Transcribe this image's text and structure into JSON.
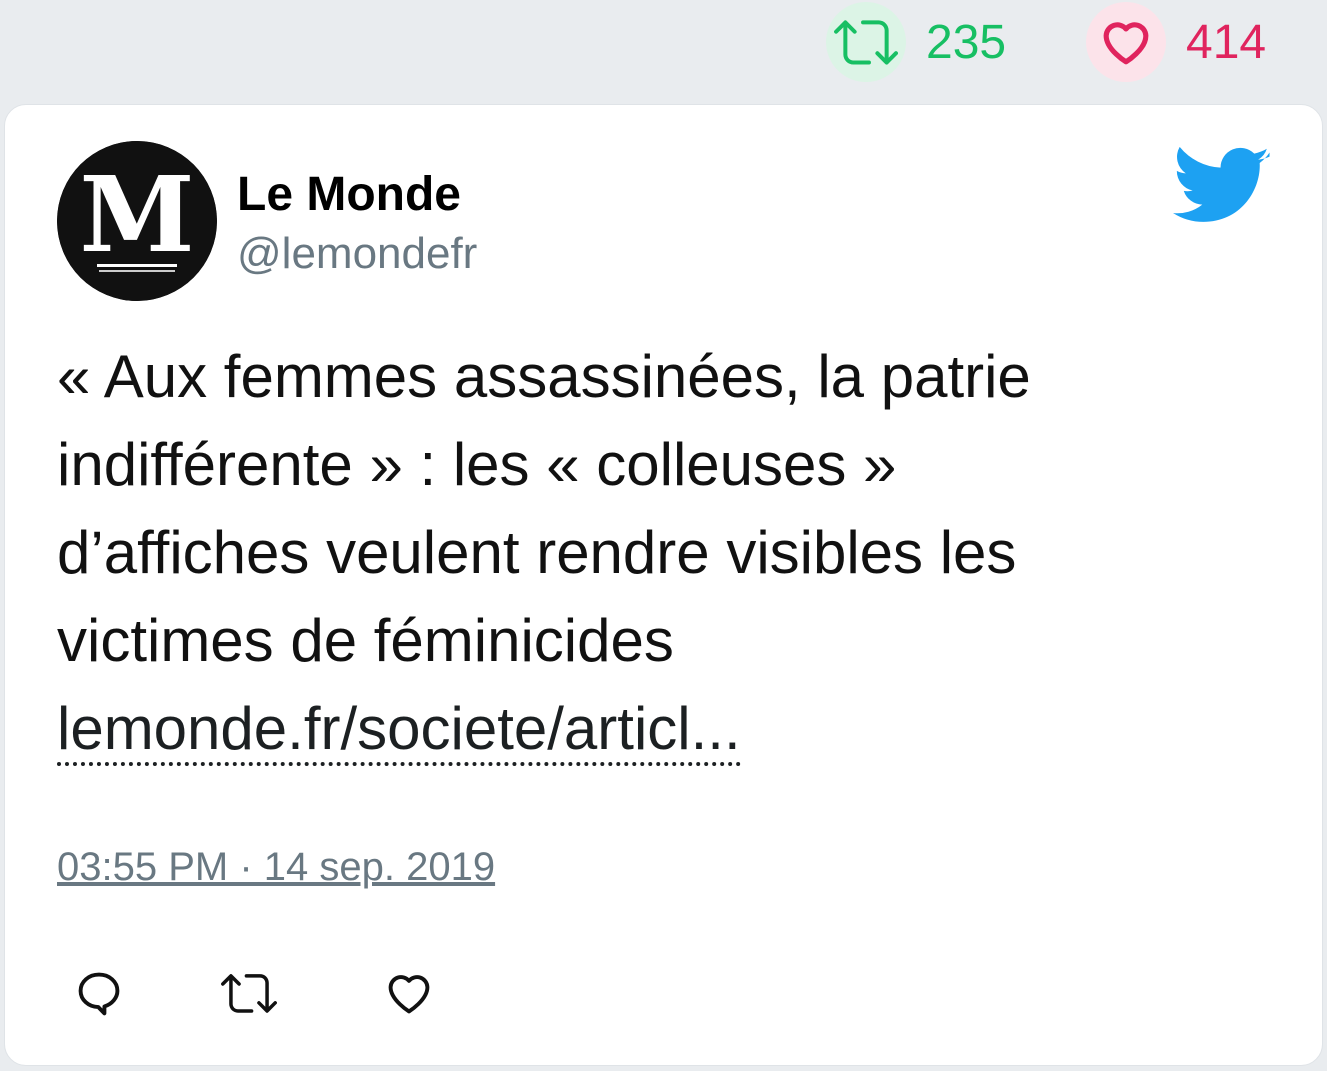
{
  "header_stats": {
    "retweet_count": "235",
    "like_count": "414",
    "retweet_icon": "retweet-icon",
    "like_icon": "heart-icon",
    "retweet_color": "#17bf63",
    "like_color": "#e0245e"
  },
  "tweet": {
    "author_name": "Le Monde",
    "author_handle": "@lemondefr",
    "avatar_icon": "le-monde-logo",
    "brand_icon": "twitter-bird-icon",
    "brand_color": "#1da1f2",
    "text_lines": [
      "« Aux femmes assassinées, la patrie",
      "indifférente » : les « colleuses »",
      "d’affiches veulent rendre visibles les",
      "victimes de féminicides"
    ],
    "link_text": "lemonde.fr/societe/articl...",
    "timestamp": "03:55 PM · 14 sep. 2019"
  },
  "actions": {
    "reply_icon": "reply-icon",
    "retweet_icon": "retweet-icon",
    "like_icon": "heart-icon"
  }
}
